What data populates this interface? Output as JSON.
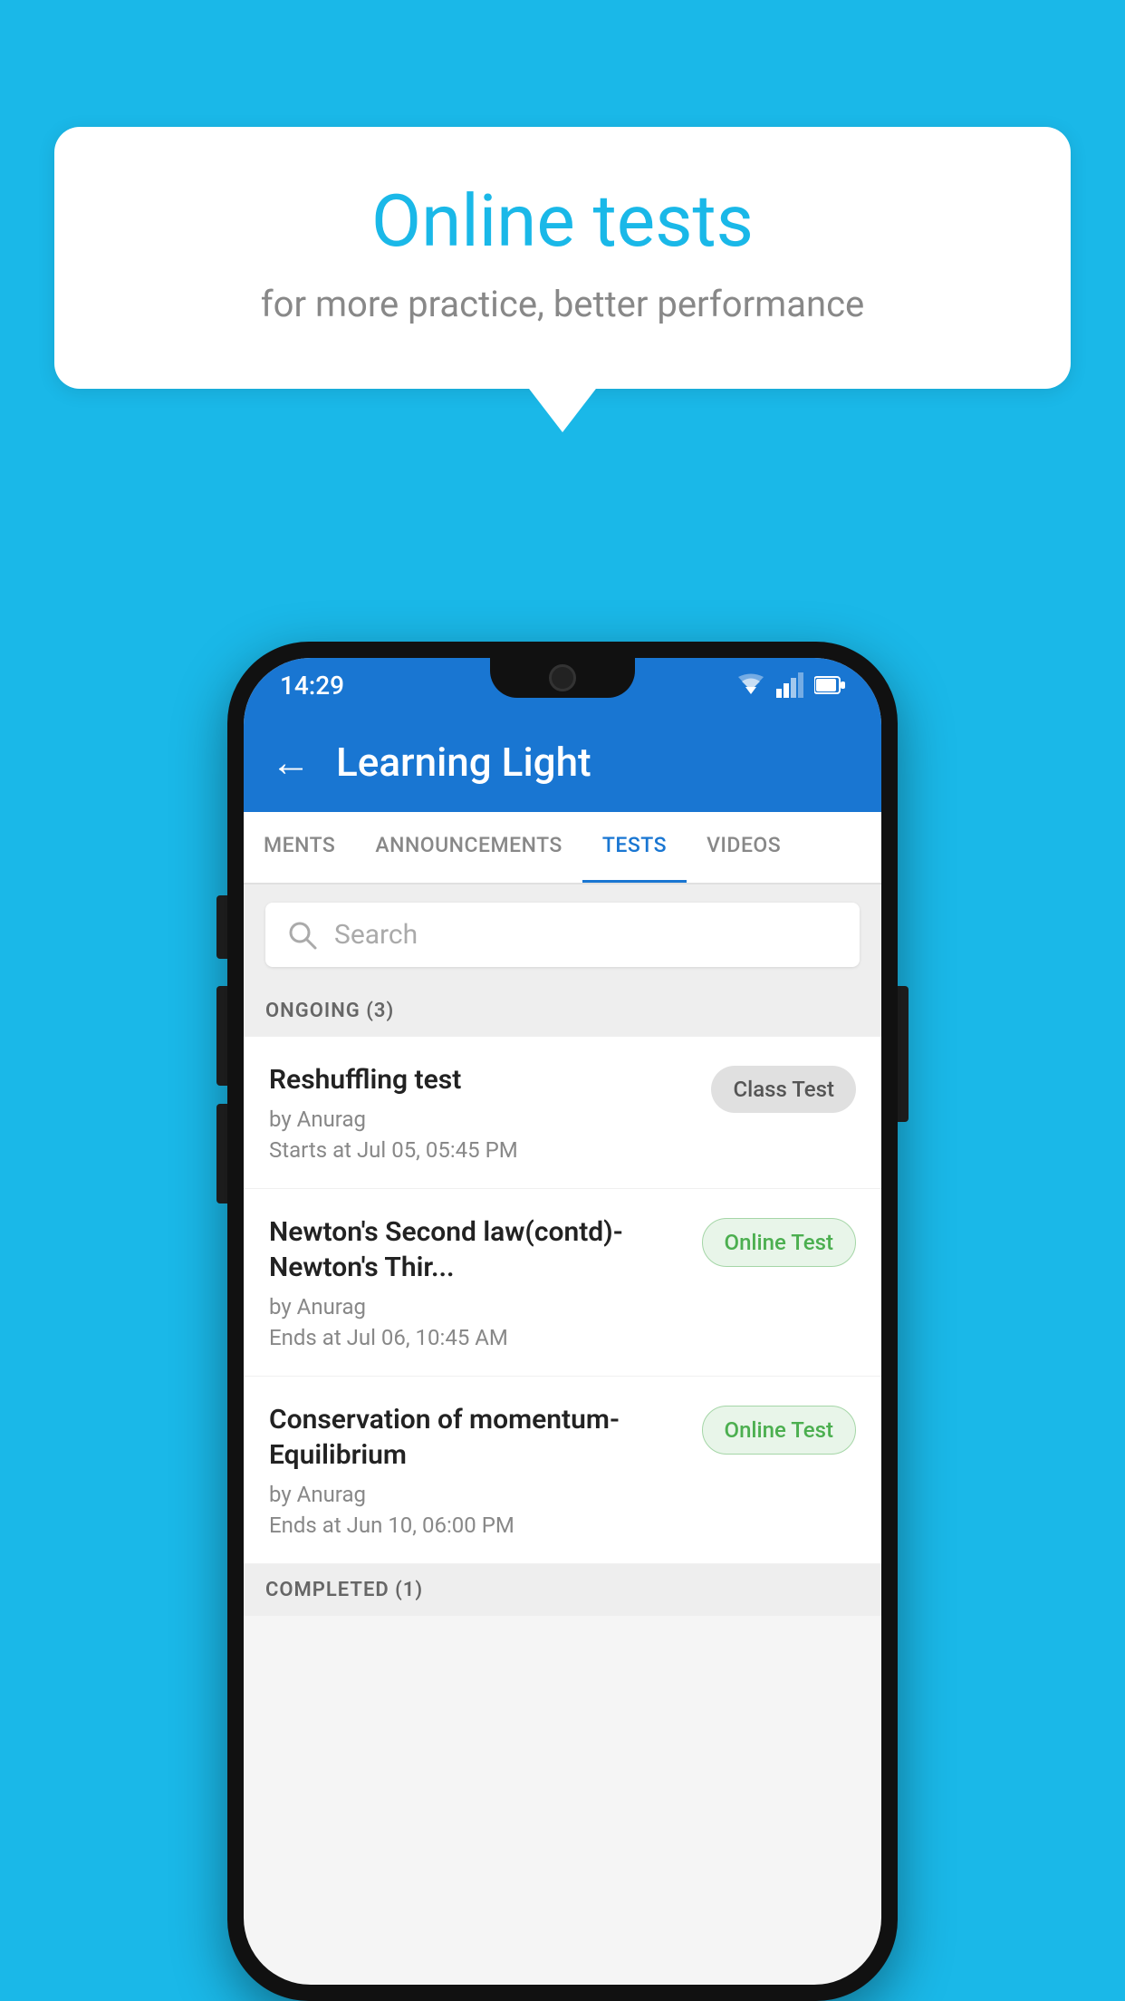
{
  "background_color": "#1ab8e8",
  "bubble": {
    "title": "Online tests",
    "subtitle": "for more practice, better performance"
  },
  "status_bar": {
    "time": "14:29",
    "wifi_icon": "wifi-icon",
    "signal_icon": "signal-icon",
    "battery_icon": "battery-icon"
  },
  "app_bar": {
    "back_label": "←",
    "title": "Learning Light"
  },
  "tabs": [
    {
      "label": "MENTS",
      "active": false
    },
    {
      "label": "ANNOUNCEMENTS",
      "active": false
    },
    {
      "label": "TESTS",
      "active": true
    },
    {
      "label": "VIDEOS",
      "active": false
    }
  ],
  "search": {
    "placeholder": "Search"
  },
  "ongoing_section": {
    "label": "ONGOING (3)"
  },
  "tests": [
    {
      "name": "Reshuffling test",
      "author": "by Anurag",
      "time_label": "Starts at",
      "time_value": "Jul 05, 05:45 PM",
      "badge": "Class Test",
      "badge_type": "class"
    },
    {
      "name": "Newton's Second law(contd)-Newton's Thir...",
      "author": "by Anurag",
      "time_label": "Ends at",
      "time_value": "Jul 06, 10:45 AM",
      "badge": "Online Test",
      "badge_type": "online"
    },
    {
      "name": "Conservation of momentum-Equilibrium",
      "author": "by Anurag",
      "time_label": "Ends at",
      "time_value": "Jun 10, 06:00 PM",
      "badge": "Online Test",
      "badge_type": "online"
    }
  ],
  "completed_section": {
    "label": "COMPLETED (1)"
  }
}
